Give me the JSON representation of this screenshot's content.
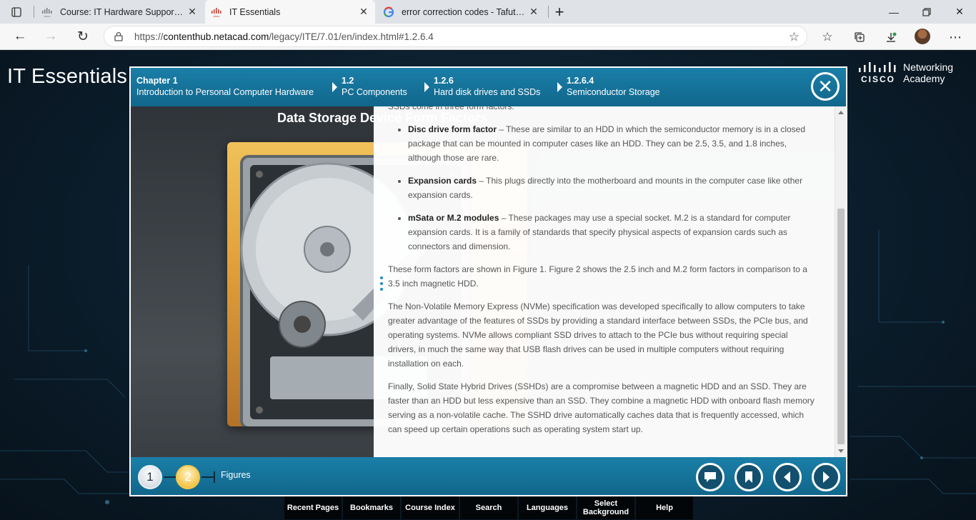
{
  "browser": {
    "tabs": [
      {
        "title": "Course: IT Hardware Support & M",
        "icon": "cisco-favicon"
      },
      {
        "title": "IT Essentials",
        "icon": "cisco-favicon"
      },
      {
        "title": "error correction codes - Tafuta na",
        "icon": "google-g-icon"
      }
    ],
    "url_scheme": "https://",
    "url_host": "contenthub.netacad.com",
    "url_path": "/legacy/ITE/7.01/en/index.html#1.2.6.4"
  },
  "site": {
    "title": "IT Essentials",
    "logo_word": "cisco",
    "logo_line1": "Networking",
    "logo_line2": "Academy"
  },
  "breadcrumbs": [
    {
      "num": "Chapter 1",
      "label": "Introduction to Personal Computer Hardware"
    },
    {
      "num": "1.2",
      "label": "PC Components"
    },
    {
      "num": "1.2.6",
      "label": "Hard disk drives and SSDs"
    },
    {
      "num": "1.2.6.4",
      "label": "Semiconductor Storage"
    }
  ],
  "figure": {
    "title": "Data Storage Device Form Factors"
  },
  "content": {
    "lead_in": "SSDs come in three form factors:",
    "bullets": [
      {
        "term": "Disc drive form factor",
        "text": " – These are similar to an HDD in which the semiconductor memory is in a closed package that can be mounted in computer cases like an HDD. They can be 2.5, 3.5, and 1.8 inches, although those are rare."
      },
      {
        "term": "Expansion cards",
        "text": " – This plugs directly into the motherboard and mounts in the computer case like other expansion cards."
      },
      {
        "term": "mSata or M.2 modules",
        "text": " – These packages may use a special socket. M.2 is a standard for computer expansion cards. It is a family of standards that specify physical aspects of expansion cards such as connectors and dimension."
      }
    ],
    "para1": "These form factors are shown in Figure 1. Figure 2 shows the 2.5 inch and M.2 form factors in comparison to a 3.5 inch magnetic HDD.",
    "para2": "The Non-Volatile Memory Express (NVMe) specification was developed specifically to allow computers to take greater advantage of the features of SSDs by providing a standard interface between SSDs, the PCIe bus, and operating systems. NVMe allows compliant SSD drives to attach to the PCIe bus without requiring special drivers, in much the same way that USB flash drives can be used in multiple computers without requiring installation on each.",
    "para3": "Finally, Solid State Hybrid Drives (SSHDs) are a compromise between a magnetic HDD and an SSD. They are faster than an HDD but less expensive than an SSD. They combine a magnetic HDD with onboard flash memory serving as a non-volatile cache. The SSHD drive automatically caches data that is frequently accessed, which can speed up certain operations such as operating system start up."
  },
  "controls": {
    "figure_buttons": [
      "1",
      "2"
    ],
    "figures_label": "Figures",
    "active_figure": "2"
  },
  "bottom_menu": [
    "Recent Pages",
    "Bookmarks",
    "Course Index",
    "Search",
    "Languages",
    "Select Background",
    "Help"
  ],
  "colors": {
    "accent": "#1a7fa8",
    "active_figure": "#f2b21c"
  }
}
